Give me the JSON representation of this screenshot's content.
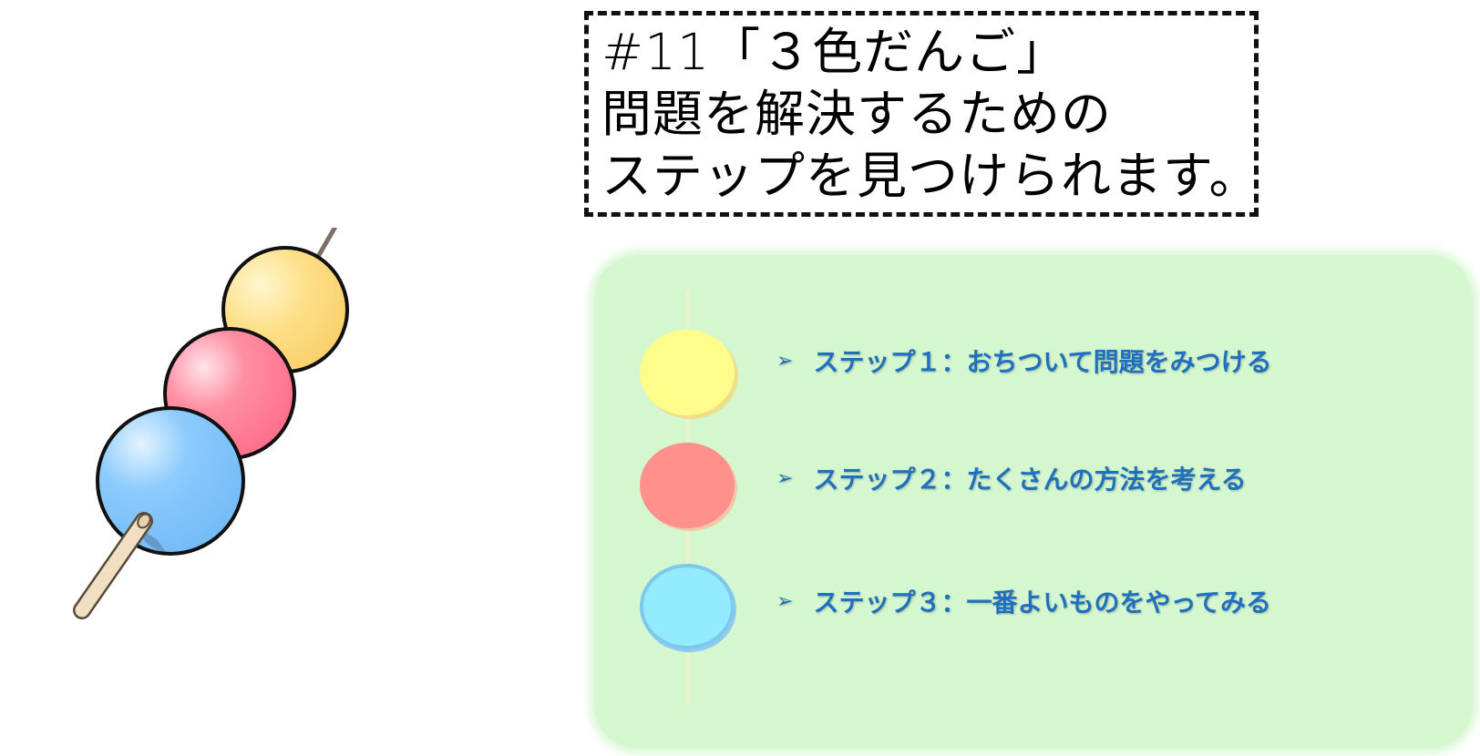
{
  "title": {
    "lines": [
      "#11「３色だんご」",
      "問題を解決するための",
      "ステップを見つけられます。"
    ]
  },
  "steps": [
    {
      "label": "ステップ１：おちついて問題をみつける",
      "icon": "arrow-bullet-icon",
      "ball_color": "#fffd8a"
    },
    {
      "label": "ステップ２：たくさんの方法を考える",
      "icon": "arrow-bullet-icon",
      "ball_color": "#ff908c"
    },
    {
      "label": "ステップ３：一番よいものをやってみる",
      "icon": "arrow-bullet-icon",
      "ball_color": "#93ecfd"
    }
  ],
  "colors": {
    "panel": "#d4f7cf",
    "step_text": "#1f70bf",
    "dango_yellow": "#fde08a",
    "dango_pink": "#ff7a92",
    "dango_blue": "#80c4fb"
  }
}
